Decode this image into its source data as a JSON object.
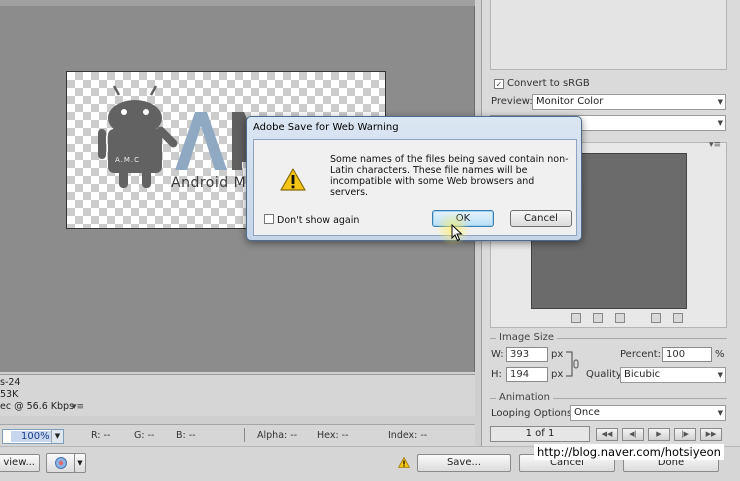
{
  "preview": {
    "canvas_brand_text": "Android M",
    "canvas_small_text": "A.M.C",
    "info_lines": [
      "s-24",
      "53K",
      "ec @ 56.6 Kbps"
    ]
  },
  "status": {
    "zoom": "100%",
    "r": "R: --",
    "g": "G: --",
    "b": "B: --",
    "alpha": "Alpha: --",
    "hex": "Hex: --",
    "index": "Index: --"
  },
  "bottom": {
    "preview_label": "view...",
    "save_label": "Save...",
    "cancel_label": "Cancel",
    "done_label": "Done"
  },
  "settings": {
    "convert_label": "Convert to sRGB",
    "convert_checked": true,
    "preview_label": "Preview:",
    "preview_value": "Monitor Color",
    "image_size_title": "Image Size",
    "w_label": "W:",
    "w_value": "393",
    "h_label": "H:",
    "h_value": "194",
    "px_unit": "px",
    "percent_label": "Percent:",
    "percent_value": "100",
    "percent_unit": "%",
    "quality_label": "Quality:",
    "quality_value": "Bicubic",
    "animation_title": "Animation",
    "looping_label": "Looping Options:",
    "looping_value": "Once",
    "frame_counter": "1 of 1"
  },
  "dialog": {
    "title": "Adobe Save for Web Warning",
    "message": "Some names of the files being saved contain non-Latin characters. These file names will be incompatible with some Web browsers and servers.",
    "dont_show_label": "Don't show again",
    "ok_label": "OK",
    "cancel_label": "Cancel"
  },
  "watermark": "http://blog.naver.com/hotsiyeon",
  "colors": {
    "canvas_gray": "#8c8c8c",
    "dialog_frame": "#c5d5e8",
    "ok_focus": "#3c7fb1",
    "warning_yellow": "#f5c518",
    "logo_blue": "#8fa9c3"
  }
}
